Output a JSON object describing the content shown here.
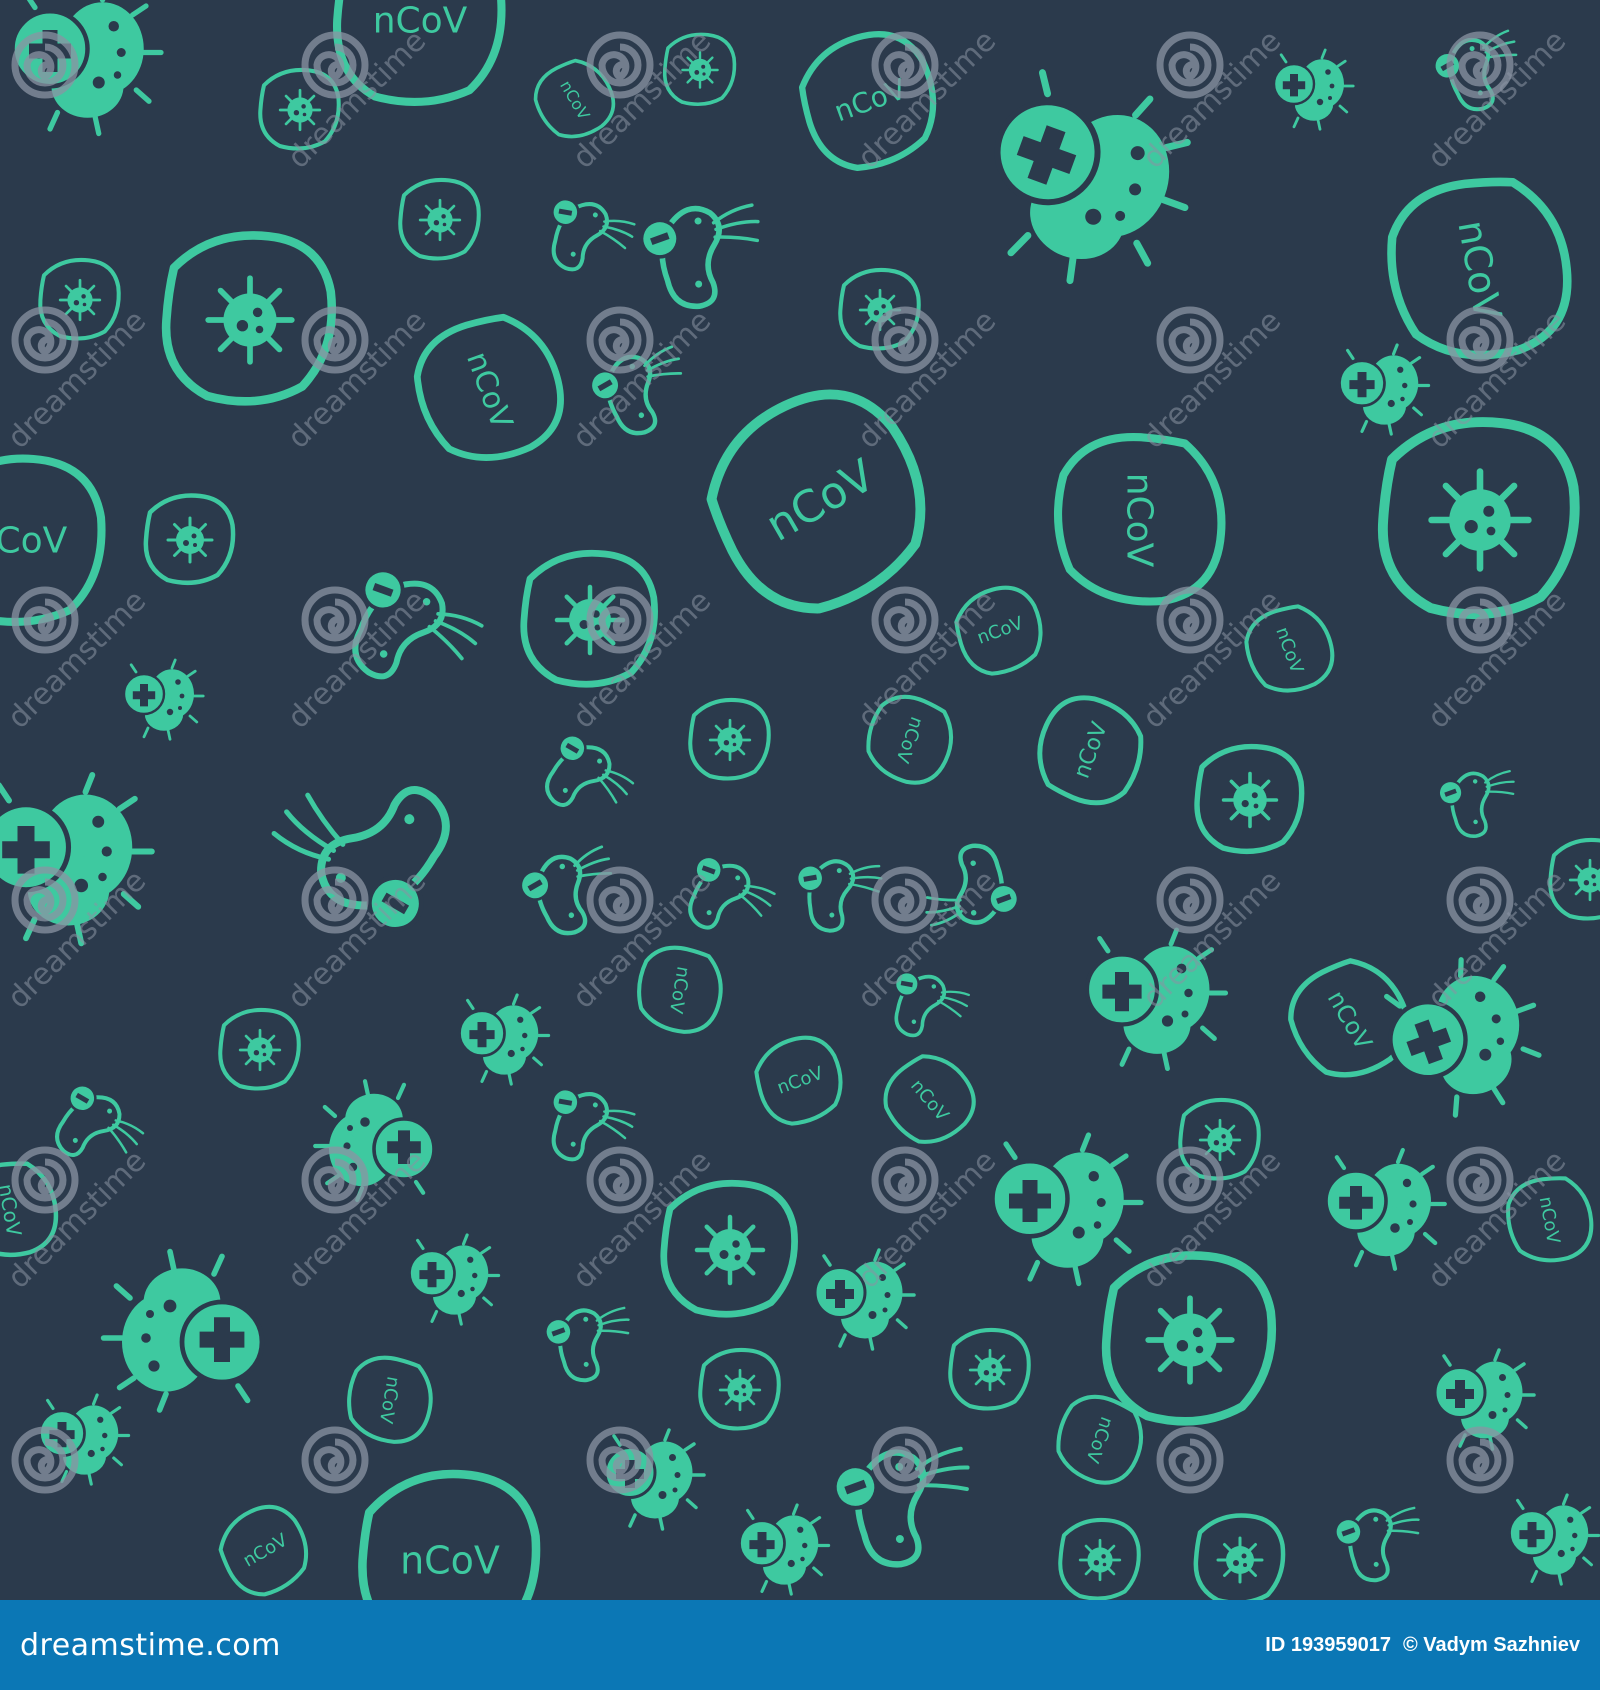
{
  "background_color": "#2b3a4c",
  "icon_color": "#3ec9a0",
  "watermark": {
    "text": "dreamstime",
    "icon": "spiral-logo-icon"
  },
  "pattern": {
    "icon_types": [
      "bacteria-plus-icon",
      "bacteria-minus-icon",
      "virus-cell-icon",
      "ncov-badge-icon"
    ],
    "ncov_label": "nCoV"
  },
  "footer": {
    "brand": "dreamstime.com",
    "id_label": "ID 193959017",
    "author": "© Vadym Sazhniev",
    "bar_color": "#0b77b5"
  }
}
